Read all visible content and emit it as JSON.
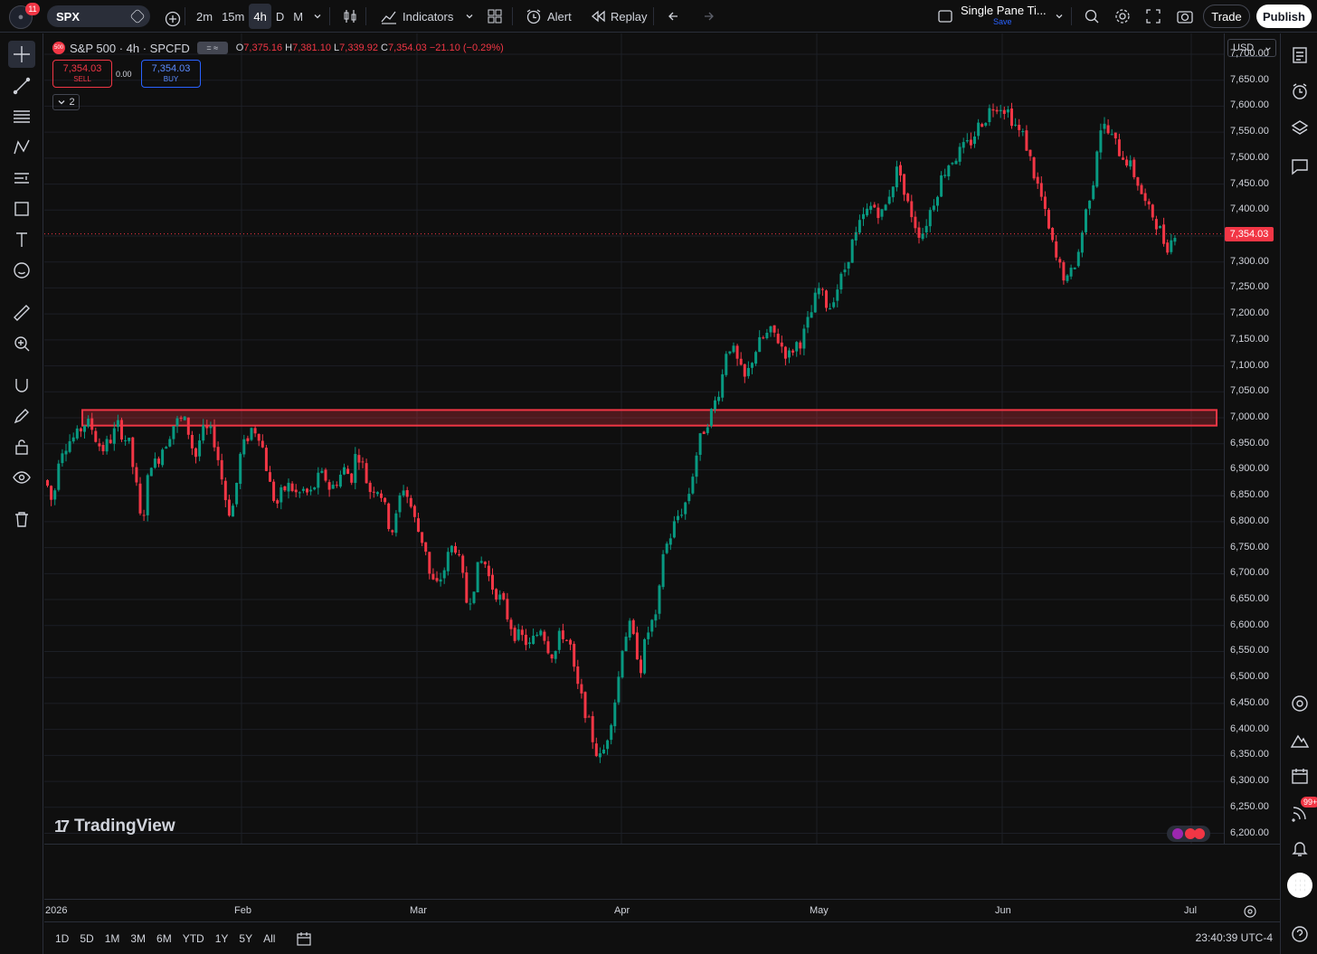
{
  "app": {
    "notification_count": "11",
    "symbol": "SPX",
    "intervals": [
      {
        "label": "2m",
        "active": false
      },
      {
        "label": "15m",
        "active": false
      },
      {
        "label": "4h",
        "active": true
      },
      {
        "label": "D",
        "active": false
      },
      {
        "label": "M",
        "active": false
      }
    ],
    "indicators_label": "Indicators",
    "alert_label": "Alert",
    "replay_label": "Replay",
    "layout_name": "Single Pane Ti...",
    "layout_save": "Save",
    "trade_label": "Trade",
    "publish_label": "Publish"
  },
  "legend": {
    "logo_text": "500",
    "title": "S&P 500 · 4h · SPCFD",
    "toggle_text": "= ≈",
    "open_key": "O",
    "open": "7,375.16",
    "high_key": "H",
    "high": "7,381.10",
    "low_key": "L",
    "low": "7,339.92",
    "close_key": "C",
    "close": "7,354.03",
    "change": "−21.10 (−0.29%)"
  },
  "trade": {
    "sell_price": "7,354.03",
    "sell_label": "SELL",
    "spread": "0.00",
    "buy_price": "7,354.03",
    "buy_label": "BUY",
    "collapse": "2"
  },
  "price_axis": {
    "currency": "USD",
    "current_price": "7,354.03",
    "labels": [
      "7,700.00",
      "7,650.00",
      "7,600.00",
      "7,550.00",
      "7,500.00",
      "7,450.00",
      "7,400.00",
      "7,350.00",
      "7,300.00",
      "7,250.00",
      "7,200.00",
      "7,150.00",
      "7,100.00",
      "7,050.00",
      "7,000.00",
      "6,950.00",
      "6,900.00",
      "6,850.00",
      "6,800.00",
      "6,750.00",
      "6,700.00",
      "6,650.00",
      "6,600.00",
      "6,550.00",
      "6,500.00",
      "6,450.00",
      "6,400.00",
      "6,350.00",
      "6,300.00",
      "6,250.00",
      "6,200.00"
    ]
  },
  "time_axis": {
    "labels": [
      "2026",
      "Feb",
      "Mar",
      "Apr",
      "May",
      "Jun",
      "Jul"
    ]
  },
  "ranges": [
    "1D",
    "5D",
    "1M",
    "3M",
    "6M",
    "YTD",
    "1Y",
    "5Y",
    "All"
  ],
  "clock": "23:40:39 UTC-4",
  "watermark": "TradingView",
  "right_badge": "99+",
  "chart_data": {
    "type": "candlestick",
    "ylim": [
      6180,
      7740
    ],
    "colors": {
      "up": "#089981",
      "down": "#f23645",
      "zone": "#f23645"
    },
    "zone": {
      "low": 6985,
      "high": 7015
    },
    "current_price": 7354.03,
    "path": [
      [
        0,
        6880
      ],
      [
        8,
        6830
      ],
      [
        15,
        6935
      ],
      [
        25,
        6955
      ],
      [
        35,
        6965
      ],
      [
        42,
        6990
      ],
      [
        50,
        6985
      ],
      [
        58,
        6950
      ],
      [
        64,
        6940
      ],
      [
        72,
        6960
      ],
      [
        80,
        6985
      ],
      [
        88,
        6960
      ],
      [
        92,
        6950
      ],
      [
        100,
        6870
      ],
      [
        105,
        6800
      ],
      [
        110,
        6830
      ],
      [
        115,
        6920
      ],
      [
        122,
        6910
      ],
      [
        128,
        6940
      ],
      [
        135,
        6960
      ],
      [
        140,
        6985
      ],
      [
        148,
        6995
      ],
      [
        155,
        6990
      ],
      [
        160,
        6960
      ],
      [
        165,
        6920
      ],
      [
        172,
        6970
      ],
      [
        180,
        6975
      ],
      [
        186,
        6960
      ],
      [
        192,
        6910
      ],
      [
        198,
        6850
      ],
      [
        205,
        6810
      ],
      [
        210,
        6860
      ],
      [
        215,
        6925
      ],
      [
        222,
        6960
      ],
      [
        228,
        6980
      ],
      [
        235,
        6975
      ],
      [
        240,
        6940
      ],
      [
        248,
        6870
      ],
      [
        255,
        6830
      ],
      [
        262,
        6860
      ],
      [
        270,
        6870
      ],
      [
        278,
        6850
      ],
      [
        285,
        6860
      ],
      [
        292,
        6850
      ],
      [
        300,
        6880
      ],
      [
        308,
        6890
      ],
      [
        315,
        6860
      ],
      [
        322,
        6880
      ],
      [
        330,
        6900
      ],
      [
        338,
        6885
      ],
      [
        342,
        6925
      ],
      [
        348,
        6930
      ],
      [
        352,
        6895
      ],
      [
        358,
        6860
      ],
      [
        365,
        6870
      ],
      [
        372,
        6850
      ],
      [
        378,
        6800
      ],
      [
        385,
        6780
      ],
      [
        390,
        6835
      ],
      [
        395,
        6870
      ],
      [
        402,
        6840
      ],
      [
        410,
        6790
      ],
      [
        415,
        6770
      ],
      [
        420,
        6750
      ],
      [
        425,
        6690
      ],
      [
        432,
        6675
      ],
      [
        440,
        6705
      ],
      [
        446,
        6740
      ],
      [
        452,
        6760
      ],
      [
        460,
        6700
      ],
      [
        466,
        6640
      ],
      [
        472,
        6670
      ],
      [
        478,
        6710
      ],
      [
        484,
        6730
      ],
      [
        492,
        6680
      ],
      [
        498,
        6665
      ],
      [
        506,
        6640
      ],
      [
        512,
        6610
      ],
      [
        520,
        6580
      ],
      [
        528,
        6575
      ],
      [
        535,
        6560
      ],
      [
        542,
        6580
      ],
      [
        548,
        6600
      ],
      [
        555,
        6560
      ],
      [
        562,
        6540
      ],
      [
        570,
        6590
      ],
      [
        575,
        6575
      ],
      [
        580,
        6560
      ],
      [
        585,
        6500
      ],
      [
        590,
        6470
      ],
      [
        596,
        6440
      ],
      [
        602,
        6400
      ],
      [
        608,
        6360
      ],
      [
        614,
        6340
      ],
      [
        620,
        6380
      ],
      [
        626,
        6430
      ],
      [
        632,
        6480
      ],
      [
        638,
        6570
      ],
      [
        645,
        6600
      ],
      [
        652,
        6560
      ],
      [
        658,
        6520
      ],
      [
        664,
        6580
      ],
      [
        670,
        6605
      ],
      [
        676,
        6610
      ],
      [
        682,
        6740
      ],
      [
        688,
        6760
      ],
      [
        694,
        6790
      ],
      [
        700,
        6815
      ],
      [
        706,
        6830
      ],
      [
        712,
        6860
      ],
      [
        718,
        6920
      ],
      [
        724,
        6960
      ],
      [
        730,
        6990
      ],
      [
        736,
        7010
      ],
      [
        742,
        7040
      ],
      [
        748,
        7080
      ],
      [
        752,
        7130
      ],
      [
        756,
        7140
      ],
      [
        762,
        7120
      ],
      [
        768,
        7090
      ],
      [
        774,
        7070
      ],
      [
        780,
        7110
      ],
      [
        786,
        7135
      ],
      [
        792,
        7150
      ],
      [
        798,
        7160
      ],
      [
        804,
        7165
      ],
      [
        810,
        7150
      ],
      [
        816,
        7130
      ],
      [
        822,
        7120
      ],
      [
        828,
        7140
      ],
      [
        836,
        7150
      ],
      [
        842,
        7180
      ],
      [
        848,
        7210
      ],
      [
        854,
        7250
      ],
      [
        860,
        7230
      ],
      [
        866,
        7210
      ],
      [
        872,
        7240
      ],
      [
        878,
        7260
      ],
      [
        884,
        7290
      ],
      [
        890,
        7330
      ],
      [
        896,
        7350
      ],
      [
        902,
        7380
      ],
      [
        908,
        7395
      ],
      [
        914,
        7410
      ],
      [
        920,
        7400
      ],
      [
        926,
        7390
      ],
      [
        932,
        7430
      ],
      [
        938,
        7460
      ],
      [
        944,
        7490
      ],
      [
        950,
        7420
      ],
      [
        956,
        7400
      ],
      [
        962,
        7370
      ],
      [
        968,
        7350
      ],
      [
        974,
        7380
      ],
      [
        980,
        7410
      ],
      [
        986,
        7440
      ],
      [
        992,
        7470
      ],
      [
        998,
        7490
      ],
      [
        1004,
        7500
      ],
      [
        1010,
        7510
      ],
      [
        1016,
        7520
      ],
      [
        1022,
        7530
      ],
      [
        1028,
        7550
      ],
      [
        1034,
        7570
      ],
      [
        1040,
        7580
      ],
      [
        1046,
        7600
      ],
      [
        1052,
        7605
      ],
      [
        1058,
        7600
      ],
      [
        1064,
        7590
      ],
      [
        1070,
        7570
      ],
      [
        1076,
        7550
      ],
      [
        1082,
        7540
      ],
      [
        1088,
        7500
      ],
      [
        1094,
        7460
      ],
      [
        1100,
        7430
      ],
      [
        1106,
        7380
      ],
      [
        1112,
        7340
      ],
      [
        1118,
        7300
      ],
      [
        1124,
        7280
      ],
      [
        1130,
        7260
      ],
      [
        1136,
        7290
      ],
      [
        1142,
        7320
      ],
      [
        1148,
        7380
      ],
      [
        1154,
        7430
      ],
      [
        1160,
        7470
      ],
      [
        1164,
        7560
      ],
      [
        1170,
        7560
      ],
      [
        1176,
        7545
      ],
      [
        1182,
        7530
      ],
      [
        1188,
        7510
      ],
      [
        1194,
        7500
      ],
      [
        1200,
        7480
      ],
      [
        1206,
        7460
      ],
      [
        1212,
        7430
      ],
      [
        1218,
        7400
      ],
      [
        1224,
        7390
      ],
      [
        1230,
        7370
      ],
      [
        1236,
        7340
      ],
      [
        1242,
        7330
      ],
      [
        1248,
        7360
      ],
      [
        1254,
        7354
      ]
    ]
  }
}
